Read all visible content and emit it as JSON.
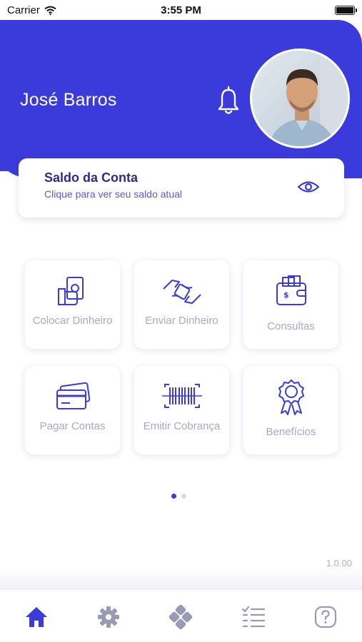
{
  "status_bar": {
    "carrier": "Carrier",
    "time": "3:55 PM"
  },
  "header": {
    "user_name": "José Barros"
  },
  "balance": {
    "title": "Saldo da Conta",
    "subtitle": "Clique para ver seu saldo atual"
  },
  "actions": [
    {
      "label": "Colocar Dinheiro",
      "icon": "money-hand-icon"
    },
    {
      "label": "Enviar Dinheiro",
      "icon": "transfer-hands-icon"
    },
    {
      "label": "Consultas",
      "icon": "wallet-icon"
    },
    {
      "label": "Pagar Contas",
      "icon": "cards-icon"
    },
    {
      "label": "Emitir Cobrança",
      "icon": "barcode-icon"
    },
    {
      "label": "Benefícios",
      "icon": "badge-icon"
    }
  ],
  "pager": {
    "current": 1,
    "total": 2
  },
  "footer": {
    "version": "1.0.00"
  },
  "tabbar": [
    "home-icon",
    "gear-icon",
    "diamond-icon",
    "checklist-icon",
    "help-icon"
  ],
  "colors": {
    "primary": "#3b3bdc",
    "tile_label": "#a8a8c8",
    "icon_gray": "#9a9ab4"
  }
}
